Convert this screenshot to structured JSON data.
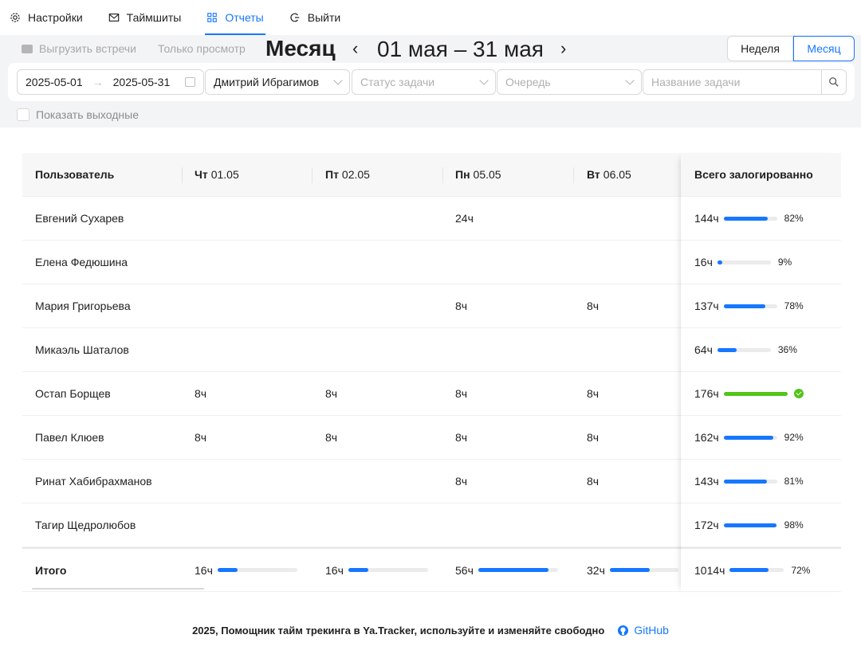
{
  "nav": {
    "items": [
      {
        "label": "Настройки",
        "icon": "gear-icon",
        "active": false
      },
      {
        "label": "Таймшиты",
        "icon": "mail-icon",
        "active": false
      },
      {
        "label": "Отчеты",
        "icon": "grid-icon",
        "active": true
      },
      {
        "label": "Выйти",
        "icon": "logout-icon",
        "active": false
      }
    ]
  },
  "toolbar": {
    "export_label": "Выгрузить встречи",
    "readonly_label": "Только просмотр",
    "period_title": "Месяц",
    "prev": "‹",
    "next": "›",
    "range": "01 мая – 31 мая",
    "week_label": "Неделя",
    "month_label": "Месяц"
  },
  "filters": {
    "date_from": "2025-05-01",
    "date_to": "2025-05-31",
    "date_sep": "→",
    "user": "Дмитрий Ибрагимов",
    "status_placeholder": "Статус задачи",
    "queue_placeholder": "Очередь",
    "task_placeholder": "Название задачи",
    "show_weekends": "Показать выходные",
    "show_weekends_checked": false
  },
  "table": {
    "header": {
      "user": "Пользователь",
      "days": [
        {
          "w": "Чт",
          "d": "01.05"
        },
        {
          "w": "Пт",
          "d": "02.05"
        },
        {
          "w": "Пн",
          "d": "05.05"
        },
        {
          "w": "Вт",
          "d": "06.05"
        }
      ],
      "total": "Всего залогированно"
    },
    "rows": [
      {
        "name": "Евгений Сухарев",
        "d": [
          "",
          "",
          "24ч",
          ""
        ],
        "total": "144ч",
        "pct": 82,
        "pct_label": "82%"
      },
      {
        "name": "Елена Федюшина",
        "d": [
          "",
          "",
          "",
          ""
        ],
        "total": "16ч",
        "pct": 9,
        "pct_label": "9%"
      },
      {
        "name": "Мария Григорьева",
        "d": [
          "",
          "",
          "8ч",
          "8ч"
        ],
        "total": "137ч",
        "pct": 78,
        "pct_label": "78%"
      },
      {
        "name": "Микаэль Шаталов",
        "d": [
          "",
          "",
          "",
          ""
        ],
        "total": "64ч",
        "pct": 36,
        "pct_label": "36%"
      },
      {
        "name": "Остап Борщев",
        "d": [
          "8ч",
          "8ч",
          "8ч",
          "8ч"
        ],
        "total": "176ч",
        "pct": 100,
        "pct_label": "",
        "complete": true
      },
      {
        "name": "Павел Клюев",
        "d": [
          "8ч",
          "8ч",
          "8ч",
          "8ч"
        ],
        "total": "162ч",
        "pct": 92,
        "pct_label": "92%"
      },
      {
        "name": "Ринат Хабибрахманов",
        "d": [
          "",
          "",
          "8ч",
          "8ч"
        ],
        "total": "143ч",
        "pct": 81,
        "pct_label": "81%"
      },
      {
        "name": "Тагир Щедролюбов",
        "d": [
          "",
          "",
          "",
          ""
        ],
        "total": "172ч",
        "pct": 98,
        "pct_label": "98%"
      }
    ],
    "totals": {
      "label": "Итого",
      "days": [
        {
          "h": "16ч",
          "pct": 25
        },
        {
          "h": "16ч",
          "pct": 25
        },
        {
          "h": "56ч",
          "pct": 88
        },
        {
          "h": "32ч",
          "pct": 50
        }
      ],
      "total": "1014ч",
      "pct": 72,
      "pct_label": "72%"
    }
  },
  "footer": {
    "text": "2025, Помощник тайм трекинга в Ya.Tracker, используйте и изменяйте свободно",
    "github": "GitHub"
  },
  "colors": {
    "accent": "#1677ff",
    "success": "#52c41a"
  }
}
